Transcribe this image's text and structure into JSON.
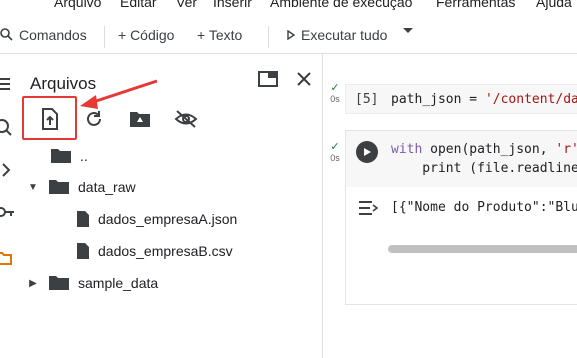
{
  "menu": [
    "Arquivo",
    "Editar",
    "Ver",
    "Inserir",
    "Ambiente de execução",
    "Ferramentas",
    "Ajuda"
  ],
  "toolbar": {
    "commands_label": "Comandos",
    "add_code_label": "+ Código",
    "add_text_label": "+ Texto",
    "run_all_label": "Executar tudo"
  },
  "files_panel": {
    "title": "Arquivos",
    "actions": [
      "upload-icon",
      "refresh-icon",
      "drive-folder-icon",
      "hide-icon"
    ],
    "tree": [
      {
        "label": "..",
        "type": "folder",
        "depth": 0
      },
      {
        "label": "data_raw",
        "type": "folder",
        "expanded": true,
        "depth": 0
      },
      {
        "label": "dados_empresaA.json",
        "type": "file",
        "depth": 1
      },
      {
        "label": "dados_empresaB.csv",
        "type": "file",
        "depth": 1
      },
      {
        "label": "sample_data",
        "type": "folder",
        "expanded": false,
        "depth": 0
      }
    ]
  },
  "cells": [
    {
      "status": "0s",
      "exec_count": "[5]",
      "code_var": "path_json",
      "code_eq": " = ",
      "code_str": "'/content/dat"
    },
    {
      "status": "0s",
      "line1_kw": "with",
      "line1_rest1": " open(path_json, ",
      "line1_str": "'r'",
      "line2": "    print (file.readline",
      "output": "[{\"Nome do Produto\":\"Blus"
    }
  ],
  "colors": {
    "highlight": "#e53935",
    "check": "#188038",
    "folder": "#3c4043"
  }
}
